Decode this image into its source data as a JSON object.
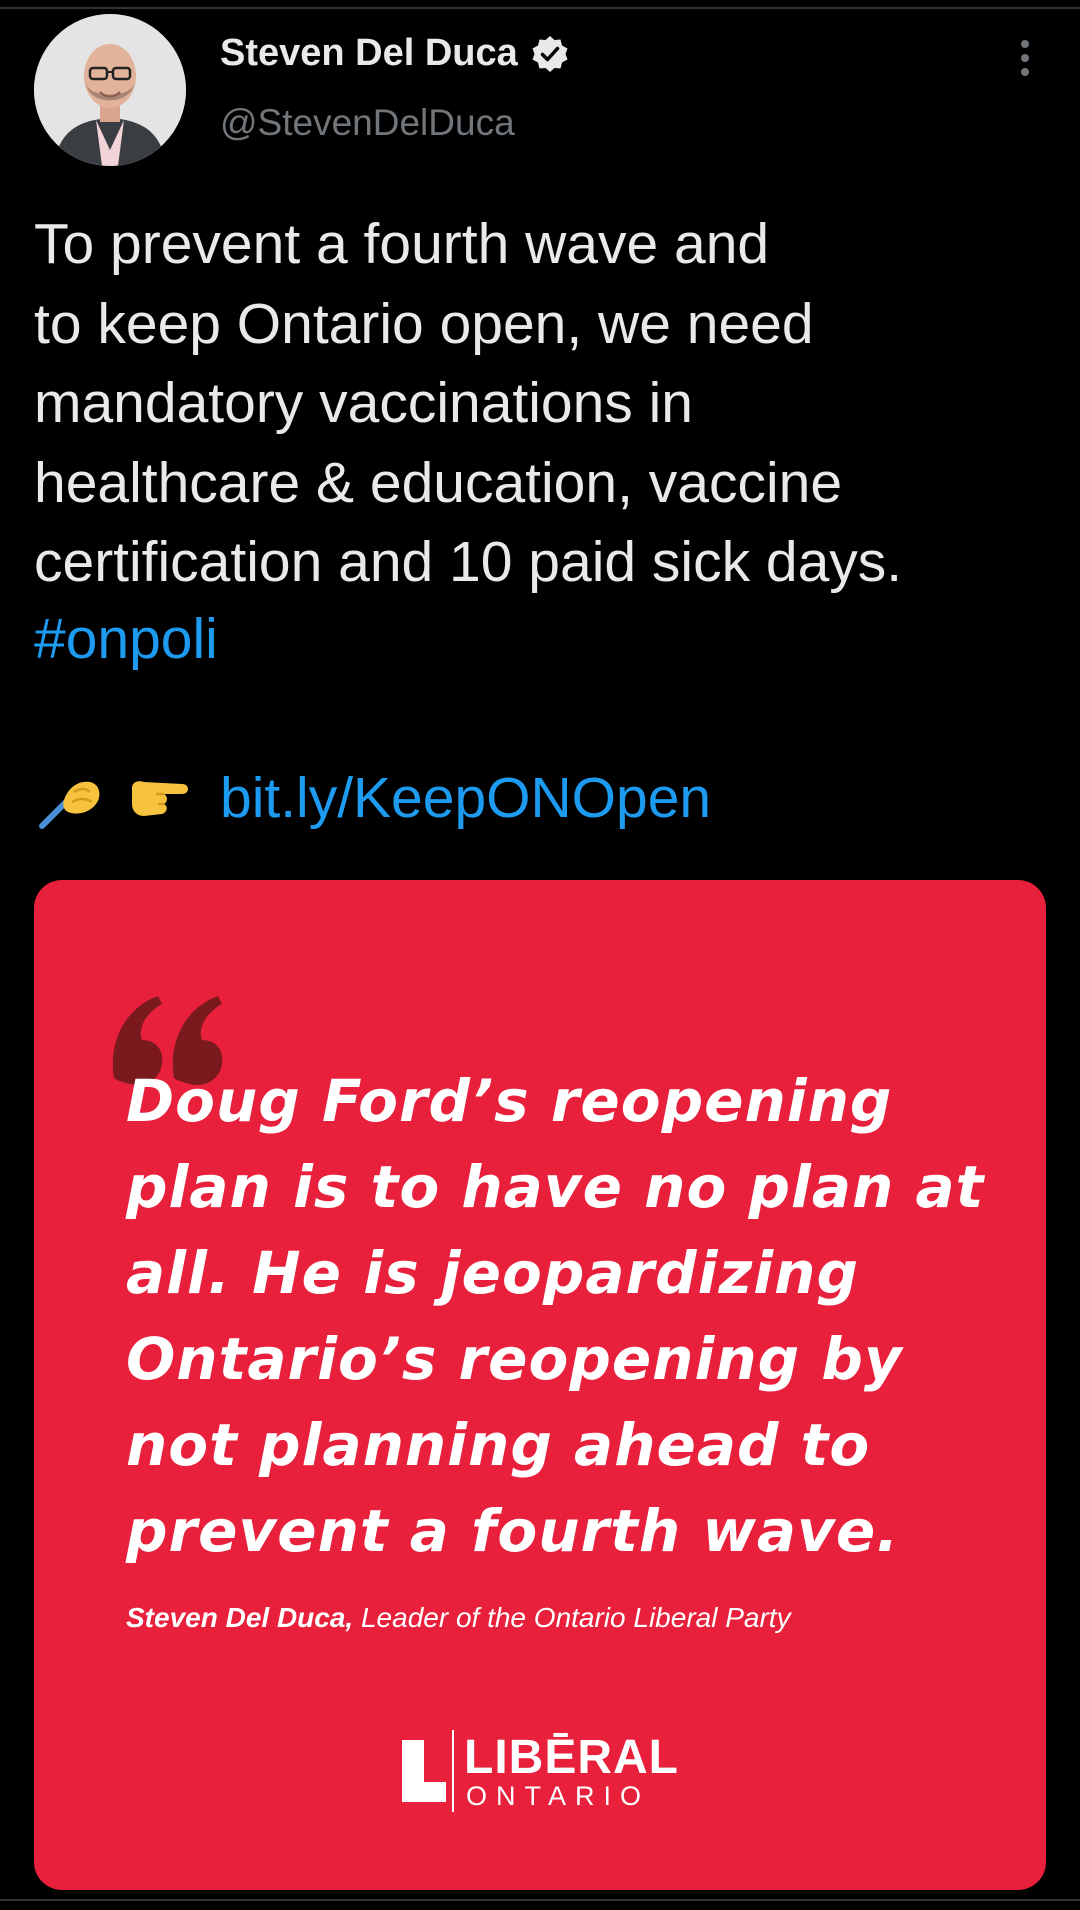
{
  "author": {
    "display_name": "Steven Del Duca",
    "handle": "@StevenDelDuca",
    "verified": true,
    "avatar_icon": "profile-photo"
  },
  "tweet": {
    "text": "To prevent a fourth wave and\nto keep Ontario open, we need\nmandatory vaccinations in\nhealthcare & education, vaccine\ncertification and 10 paid sick days.",
    "hashtag": "#onpoli",
    "emojis": [
      "writing-hand-emoji",
      "pointing-right-emoji"
    ],
    "link": "bit.ly/KeepONOpen"
  },
  "card": {
    "background_color": "#e8203b",
    "quote": "Doug Ford’s reopening plan is to have no plan at all. He is jeopardizing Ontario’s reopening by not planning ahead to prevent a fourth wave.",
    "attribution_name": "Steven Del Duca,",
    "attribution_role": "Leader of the Ontario Liberal Party",
    "logo_word": "LIBĒRAL",
    "logo_sub": "ONTARIO"
  },
  "colors": {
    "background": "#000000",
    "text": "#e7e9ea",
    "secondary_text": "#71767b",
    "link": "#1d9bf0",
    "card_red": "#e8203b"
  }
}
